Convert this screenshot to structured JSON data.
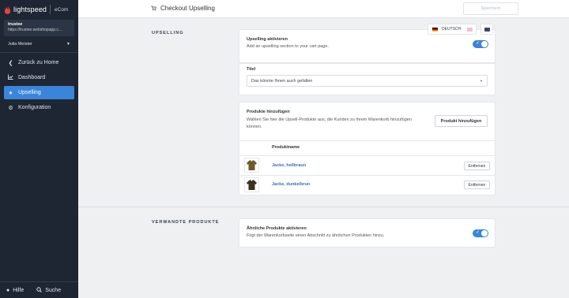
{
  "brand": {
    "name": "lightspeed",
    "product": "eCom"
  },
  "shop": {
    "name": "trustee",
    "url": "https://trustee.webshopapp.c..."
  },
  "user": {
    "name": "Julia Meister"
  },
  "nav": [
    {
      "label": "Zurück zu Home",
      "icon": "chevron-left-icon"
    },
    {
      "label": "Dashboard",
      "icon": "chart-icon"
    },
    {
      "label": "Upselling",
      "icon": "star-icon"
    },
    {
      "label": "Konfiguration",
      "icon": "gear-icon"
    }
  ],
  "footer": {
    "help": "Hilfe",
    "search": "Suche"
  },
  "topbar": {
    "title": "Checkout Upselling",
    "save": "Speichern"
  },
  "language": {
    "current": "DEUTSCH"
  },
  "upselling": {
    "section_label": "UPSELLING",
    "activate_title": "Upselling aktivieren",
    "activate_sub": "Add an upselling section to your cart page.",
    "activate_on": true,
    "title_label": "Titel",
    "title_value": "Das könnte Ihnen auch gefallen",
    "products_title": "Produkte hinzufügen",
    "products_sub": "Wählen Sie hier die Upsell-Produkte aus, die Kunden zu ihrem Warenkorb hinzufügen können.",
    "add_button": "Produkt hinzufügen",
    "column_header": "Produktname",
    "products": [
      {
        "name": "Jacke, hellbraun",
        "remove": "Entfernen",
        "color": "#6b5a2a"
      },
      {
        "name": "Jacke, dunkelbrun",
        "remove": "Entfernen",
        "color": "#3b2f1e"
      }
    ]
  },
  "related": {
    "section_label": "VERWANDTE PRODUKTE",
    "title": "Ähnliche Produkte aktivieren",
    "sub": "Fügt der Warenkorbseite einen Abschnitt zu ähnlichen Produkten hinzu.",
    "on": true
  },
  "colors": {
    "accent": "#3a85d9",
    "sidebar": "#1e2634",
    "link": "#3a6fb5"
  }
}
